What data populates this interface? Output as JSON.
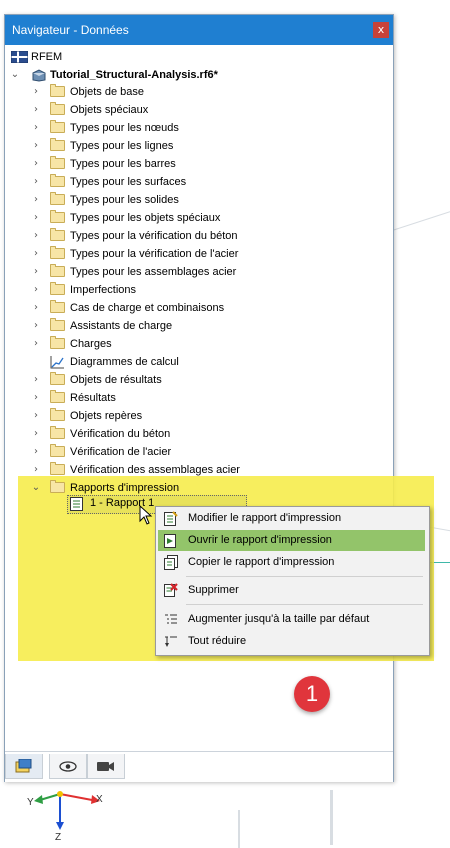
{
  "window": {
    "title": "Navigateur - Données",
    "close_glyph": "x"
  },
  "tree": {
    "root": "RFEM",
    "project": "Tutorial_Structural-Analysis.rf6*",
    "items": [
      "Objets de base",
      "Objets spéciaux",
      "Types pour les nœuds",
      "Types pour les lignes",
      "Types pour les barres",
      "Types pour les surfaces",
      "Types pour les solides",
      "Types pour les objets spéciaux",
      "Types pour la vérification du béton",
      "Types pour la vérification de l'acier",
      "Types pour les assemblages acier",
      "Imperfections",
      "Cas de charge et combinaisons",
      "Assistants de charge",
      "Charges",
      "Diagrammes de calcul",
      "Objets de résultats",
      "Résultats",
      "Objets repères",
      "Vérification du béton",
      "Vérification de l'acier",
      "Vérification des assemblages acier",
      "Rapports d'impression"
    ],
    "report_child": "1 - Rapport 1"
  },
  "context_menu": {
    "items": [
      "Modifier le rapport d'impression",
      "Ouvrir le rapport d'impression",
      "Copier le rapport d'impression",
      "Supprimer",
      "Augmenter jusqu'à la taille par défaut",
      "Tout réduire"
    ],
    "selected_index": 1
  },
  "badge": {
    "number": "1"
  },
  "axes": {
    "x": "X",
    "y": "Y",
    "z": "Z"
  },
  "colors": {
    "titlebar": "#1f7fd1",
    "highlight": "#f6ec4c",
    "menu_selected": "#93c46a",
    "badge": "#e0353c"
  }
}
